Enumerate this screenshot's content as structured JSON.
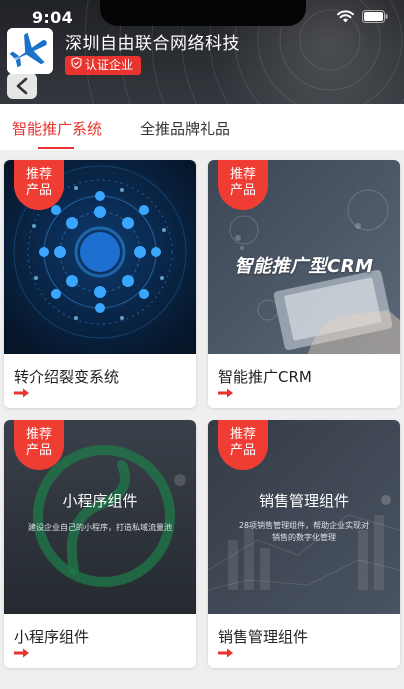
{
  "status_bar": {
    "time": "9:04"
  },
  "company": {
    "name": "深圳自由联合网络科技",
    "badge": "认证企业",
    "logo_icon": "airplane-icon"
  },
  "tabs": [
    {
      "label": "智能推广系统",
      "active": true
    },
    {
      "label": "全推品牌礼品",
      "active": false
    }
  ],
  "products": [
    {
      "title": "转介绍裂变系统",
      "badge_line1": "推荐",
      "badge_line2": "产品",
      "image_caption": "",
      "image_subcaption": ""
    },
    {
      "title": "智能推广CRM",
      "badge_line1": "推荐",
      "badge_line2": "产品",
      "image_caption": "智能推广型CRM",
      "image_subcaption": ""
    },
    {
      "title": "小程序组件",
      "badge_line1": "推荐",
      "badge_line2": "产品",
      "image_caption": "小程序组件",
      "image_subcaption": "建设企业自己的小程序，打造私域流量池"
    },
    {
      "title": "销售管理组件",
      "badge_line1": "推荐",
      "badge_line2": "产品",
      "image_caption": "销售管理组件",
      "image_subcaption": "28项销售管理组件，帮助企业实现对销售的数字化管理"
    }
  ],
  "colors": {
    "accent": "#e8332e",
    "badge": "#f03d34",
    "header_dark": "#2a2c31"
  },
  "icons": {
    "back": "chevron-left-icon",
    "wifi": "wifi-icon",
    "battery": "battery-icon",
    "certified": "shield-check-icon",
    "card_arrow": "arrow-right-icon"
  }
}
